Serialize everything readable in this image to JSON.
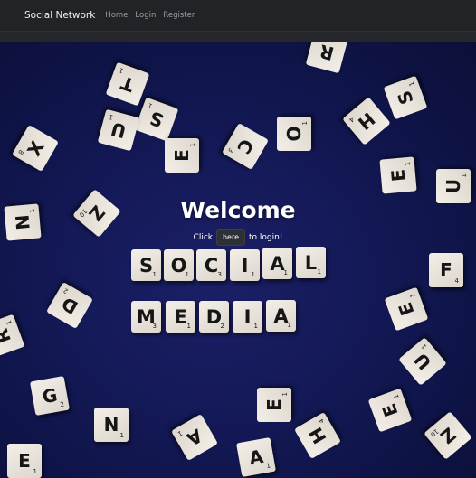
{
  "navbar": {
    "brand": "Social Network",
    "links": [
      "Home",
      "Login",
      "Register"
    ]
  },
  "hero": {
    "title": "Welcome",
    "login_prefix": "Click",
    "login_button": "here",
    "login_suffix": "to login!"
  },
  "word_social": [
    {
      "letter": "S",
      "points": "1"
    },
    {
      "letter": "O",
      "points": "1"
    },
    {
      "letter": "C",
      "points": "3"
    },
    {
      "letter": "I",
      "points": "1"
    },
    {
      "letter": "A",
      "points": "1"
    },
    {
      "letter": "L",
      "points": "1"
    }
  ],
  "word_media": [
    {
      "letter": "M",
      "points": "3"
    },
    {
      "letter": "E",
      "points": "1"
    },
    {
      "letter": "D",
      "points": "2"
    },
    {
      "letter": "I",
      "points": "1"
    },
    {
      "letter": "A",
      "points": "1"
    }
  ],
  "scattered_tiles": [
    {
      "letter": "R",
      "points": "1"
    },
    {
      "letter": "T",
      "points": "1"
    },
    {
      "letter": "S",
      "points": "1"
    },
    {
      "letter": "U",
      "points": "1"
    },
    {
      "letter": "E",
      "points": "1"
    },
    {
      "letter": "C",
      "points": "3"
    },
    {
      "letter": "O",
      "points": "1"
    },
    {
      "letter": "H",
      "points": "4"
    },
    {
      "letter": "S",
      "points": "1"
    },
    {
      "letter": "X",
      "points": "8"
    },
    {
      "letter": "E",
      "points": "1"
    },
    {
      "letter": "U",
      "points": "1"
    },
    {
      "letter": "N",
      "points": "1"
    },
    {
      "letter": "Z",
      "points": "10"
    },
    {
      "letter": "N",
      "points": "1"
    },
    {
      "letter": "F",
      "points": "4"
    },
    {
      "letter": "D",
      "points": "2"
    },
    {
      "letter": "E",
      "points": "1"
    },
    {
      "letter": "R",
      "points": "1"
    },
    {
      "letter": "U",
      "points": "1"
    },
    {
      "letter": "G",
      "points": "2"
    },
    {
      "letter": "E",
      "points": "1"
    },
    {
      "letter": "A",
      "points": "1"
    },
    {
      "letter": "E",
      "points": "1"
    },
    {
      "letter": "H",
      "points": "4"
    },
    {
      "letter": "E",
      "points": "1"
    },
    {
      "letter": "Z",
      "points": "10"
    },
    {
      "letter": "A",
      "points": "1"
    }
  ],
  "colors": {
    "navbar_bg": "#222326",
    "hero_bg": "#151a5a",
    "tile": "#e8e3da",
    "button_bg": "#2d3035"
  }
}
